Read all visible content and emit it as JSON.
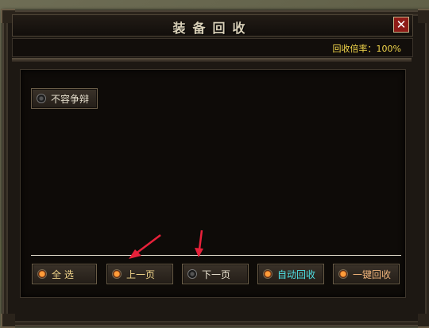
{
  "window": {
    "title": "装备回收",
    "close_glyph": "✕"
  },
  "rate": {
    "text": "回收倍率：100%"
  },
  "options": {
    "no_dispute": {
      "label": "不容争辩",
      "checked": false
    }
  },
  "buttons": {
    "select_all": {
      "label": "全  选",
      "bullet": "on"
    },
    "prev_page": {
      "label": "上一页",
      "bullet": "on"
    },
    "next_page": {
      "label": "下一页",
      "bullet": "off"
    },
    "auto_recycle": {
      "label": "自动回收",
      "bullet": "on",
      "color": "#4fe0e6"
    },
    "one_click_recycle": {
      "label": "一键回收",
      "bullet": "on",
      "color": "#f0b37a"
    }
  },
  "annotations": {
    "arrow_color": "#e8213a"
  }
}
